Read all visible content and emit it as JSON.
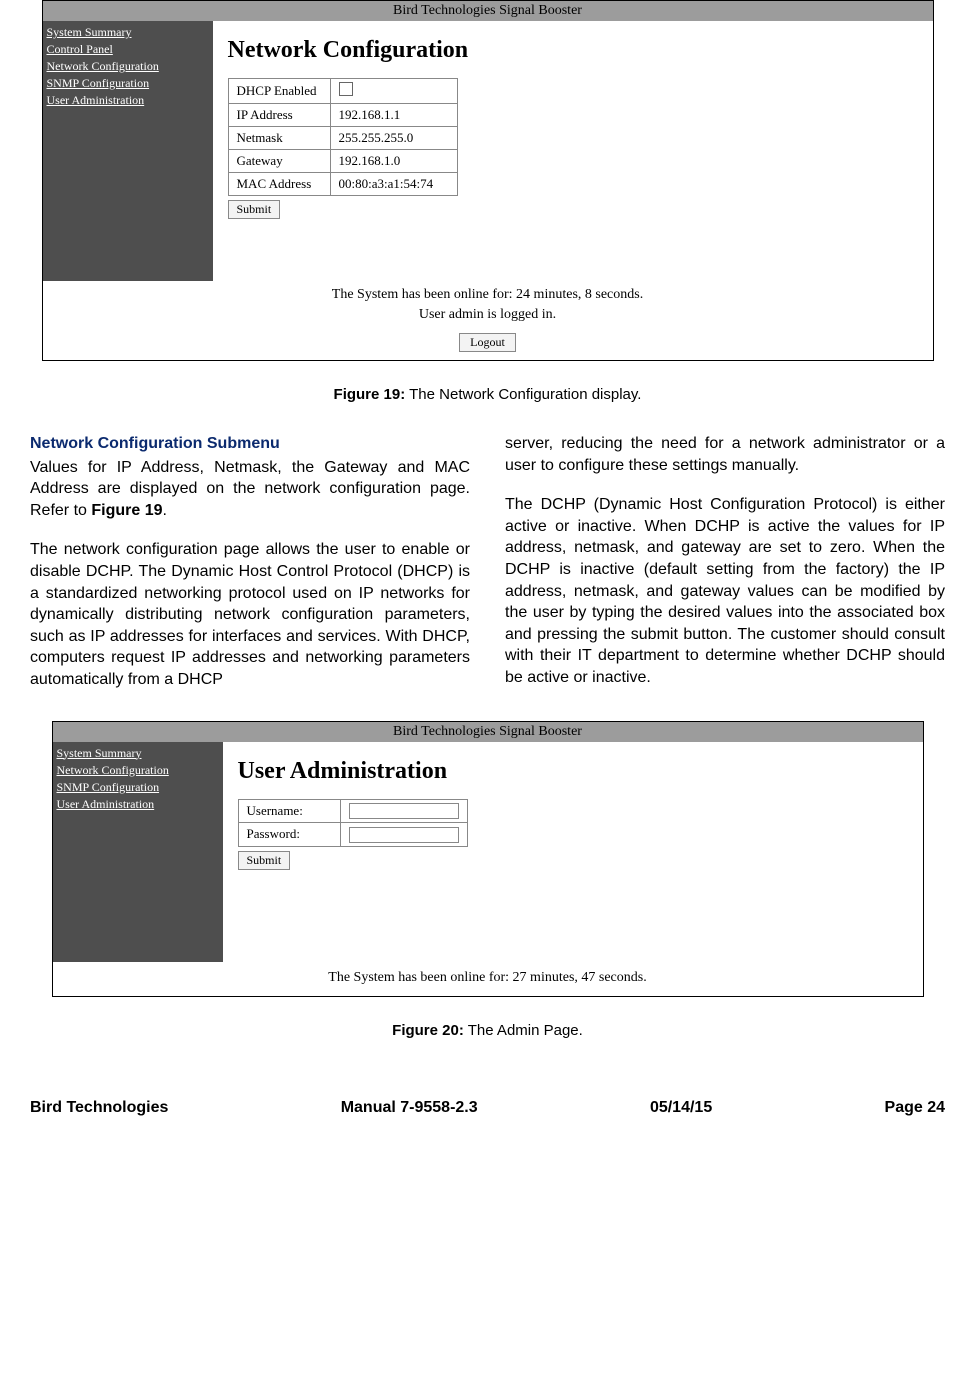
{
  "fig19": {
    "titlebar": "Bird Technologies Signal Booster",
    "sidebar": [
      "System Summary",
      "Control Panel",
      "Network Configuration",
      "SNMP Configuration",
      "User Administration"
    ],
    "heading": "Network Configuration",
    "rows": [
      {
        "label": "DHCP Enabled",
        "type": "checkbox"
      },
      {
        "label": "IP Address",
        "value": "192.168.1.1"
      },
      {
        "label": "Netmask",
        "value": "255.255.255.0"
      },
      {
        "label": "Gateway",
        "value": "192.168.1.0"
      },
      {
        "label": "MAC Address",
        "value": "00:80:a3:a1:54:74"
      }
    ],
    "submit": "Submit",
    "status_uptime": "The System has been online for: 24 minutes, 8 seconds.",
    "status_user": "User admin is logged in.",
    "logout": "Logout",
    "caption_label": "Figure 19:",
    "caption_text": "The Network Configuration display."
  },
  "body": {
    "section_head": "Network Configuration Submenu",
    "left_p1a": "Values for IP Address, Netmask, the Gateway and MAC Address are displayed on the network config­uration page. Refer to ",
    "left_p1_bold": "Figure 19",
    "left_p1b": ".",
    "left_p2": "The network configuration page allows the user to enable or disable DCHP. The Dynamic Host Con­trol Protocol (DHCP) is a standardized networking protocol used on IP networks for dynamically dis­tributing network configuration parameters, such as IP addresses for interfaces and services. With DHCP, computers request IP addresses and net­working parameters automatically from a DHCP",
    "right_p1": "server, reducing the need for a network administra­tor or a user to configure these settings manually.",
    "right_p2": "The DCHP (Dynamic Host Configuration Protocol) is either active or inactive. When DCHP is active the values for IP address, netmask, and gateway are set to zero. When the DCHP is inactive (default setting from the factory) the IP address, netmask, and gateway values can be modified by the user by typing the desired values into the associated box and pressing the submit button. The customer should consult with their IT department to deter­mine whether DCHP should be active or inactive."
  },
  "fig20": {
    "titlebar": "Bird Technologies Signal Booster",
    "sidebar": [
      "System Summary",
      "Network Configuration",
      "SNMP Configuration",
      "User Administration"
    ],
    "heading": "User Administration",
    "rows": [
      {
        "label": "Username:"
      },
      {
        "label": "Password:"
      }
    ],
    "submit": "Submit",
    "status_uptime": "The System has been online for: 27 minutes, 47 seconds.",
    "caption_label": "Figure 20:",
    "caption_text": "The Admin Page."
  },
  "footer": {
    "company": "Bird Technologies",
    "manual": "Manual 7-9558-2.3",
    "date": "05/14/15",
    "page": "Page 24"
  }
}
